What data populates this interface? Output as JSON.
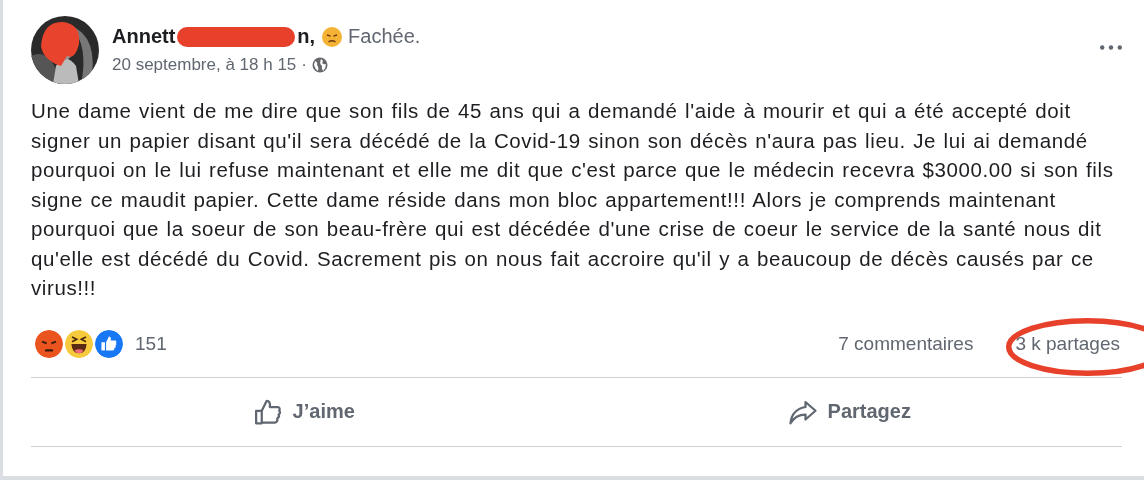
{
  "post": {
    "author": {
      "name_start": "Annett",
      "redacted": true,
      "name_end": "n,"
    },
    "feeling": {
      "kind": "angry",
      "label": "Fachée."
    },
    "date": "20 septembre, à 18 h 15",
    "separator": "·",
    "text": "Une dame vient de me dire que son fils de 45 ans qui a demandé l'aide à mourir et qui a été accepté doit signer un papier disant qu'il sera décédé de la Covid-19 sinon son décès n'aura pas lieu. Je lui ai demandé pourquoi on le lui refuse maintenant et elle me dit que c'est parce que le médecin recevra $3000.00 si son fils signe ce maudit papier. Cette dame réside dans mon bloc appartement!!! Alors je comprends maintenant pourquoi que la soeur de son beau-frère qui est décédée d'une crise de coeur le service de la santé nous dit qu'elle est décédé du Covid. Sacrement pis on nous fait accroire qu'il y a beaucoup de décès causés par ce virus!!!",
    "reactions": [
      {
        "kind": "angry"
      },
      {
        "kind": "haha"
      },
      {
        "kind": "like"
      }
    ],
    "reaction_count": "151",
    "comments": "7 commentaires",
    "shares": "3 k partages",
    "shares_circled": true,
    "actions": [
      {
        "kind": "like",
        "label": "J’aime"
      },
      {
        "kind": "share",
        "label": "Partagez"
      }
    ]
  }
}
